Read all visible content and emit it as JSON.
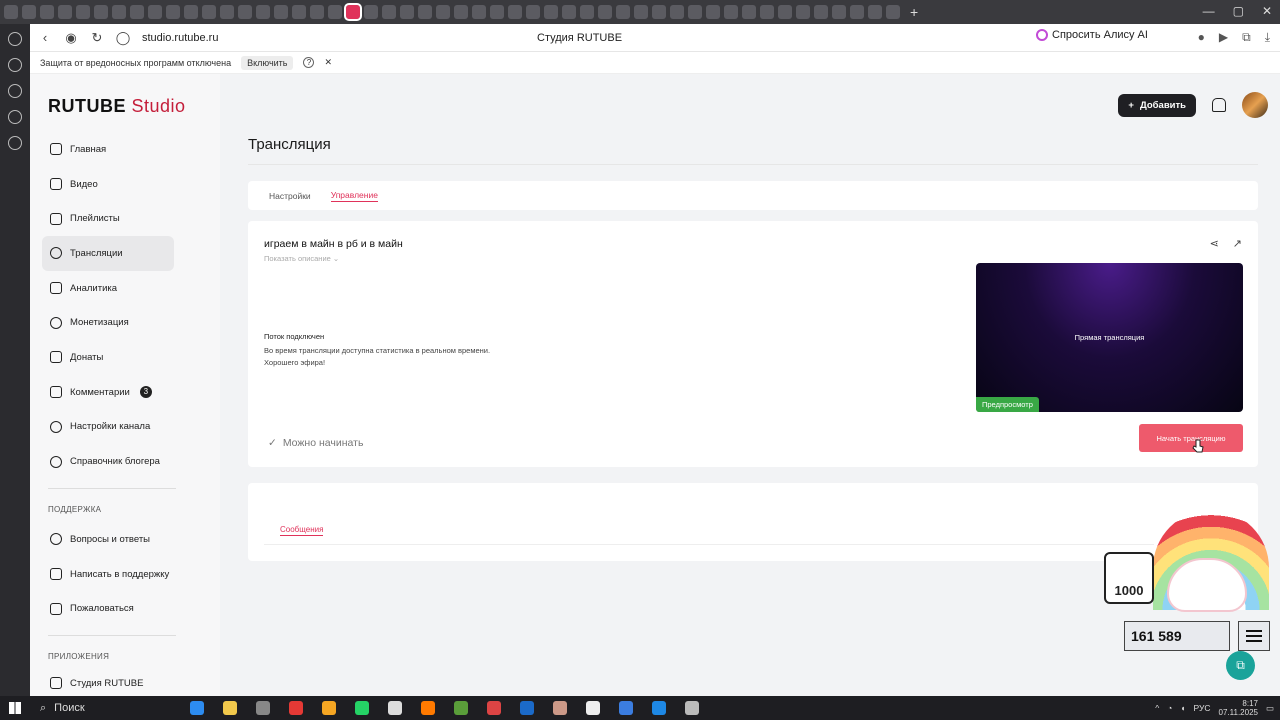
{
  "browser": {
    "url": "studio.rutube.ru",
    "page_title": "Студия RUTUBE",
    "alice_label": "Спросить Алису AI",
    "warning_text": "Защита от вредоносных программ отключена",
    "warning_enable": "Включить"
  },
  "app": {
    "logo_main": "RUTUBE",
    "logo_sub": "Studio",
    "add_button": "Добавить",
    "nav": [
      {
        "label": "Главная"
      },
      {
        "label": "Видео"
      },
      {
        "label": "Плейлисты"
      },
      {
        "label": "Трансляции"
      },
      {
        "label": "Аналитика"
      },
      {
        "label": "Монетизация"
      },
      {
        "label": "Донаты"
      },
      {
        "label": "Комментарии",
        "badge": "3"
      },
      {
        "label": "Настройки канала"
      },
      {
        "label": "Справочник блогера"
      }
    ],
    "support_title": "ПОДДЕРЖКА",
    "support": [
      {
        "label": "Вопросы и ответы"
      },
      {
        "label": "Написать в поддержку"
      },
      {
        "label": "Пожаловаться"
      }
    ],
    "apps_title": "ПРИЛОЖЕНИЯ",
    "apps": [
      {
        "label": "Студия RUTUBE"
      }
    ]
  },
  "page": {
    "title": "Трансляция",
    "tabs": [
      {
        "label": "Настройки"
      },
      {
        "label": "Управление"
      }
    ],
    "stream": {
      "title": "играем в майн в рб и в майн",
      "show_description": "Показать описание",
      "status": "Поток подключен",
      "info_line1": "Во время трансляции доступна статистика в реальном времени.",
      "info_line2": "Хорошего эфира!",
      "ready": "Можно начинать",
      "preview_title": "Прямая трансляция",
      "preview_badge": "Предпросмотр",
      "start_button": "Начать трансляцию"
    },
    "messages_tab": "Сообщения"
  },
  "overlay": {
    "box_number": "1000",
    "counter": "161 589"
  },
  "taskbar": {
    "search": "Поиск",
    "lang": "РУС",
    "time": "8:17",
    "date": "07.11.2025"
  },
  "colors": {
    "accent": "#e0325a",
    "start_button": "#ee5a6c",
    "preview_badge": "#39a845"
  }
}
